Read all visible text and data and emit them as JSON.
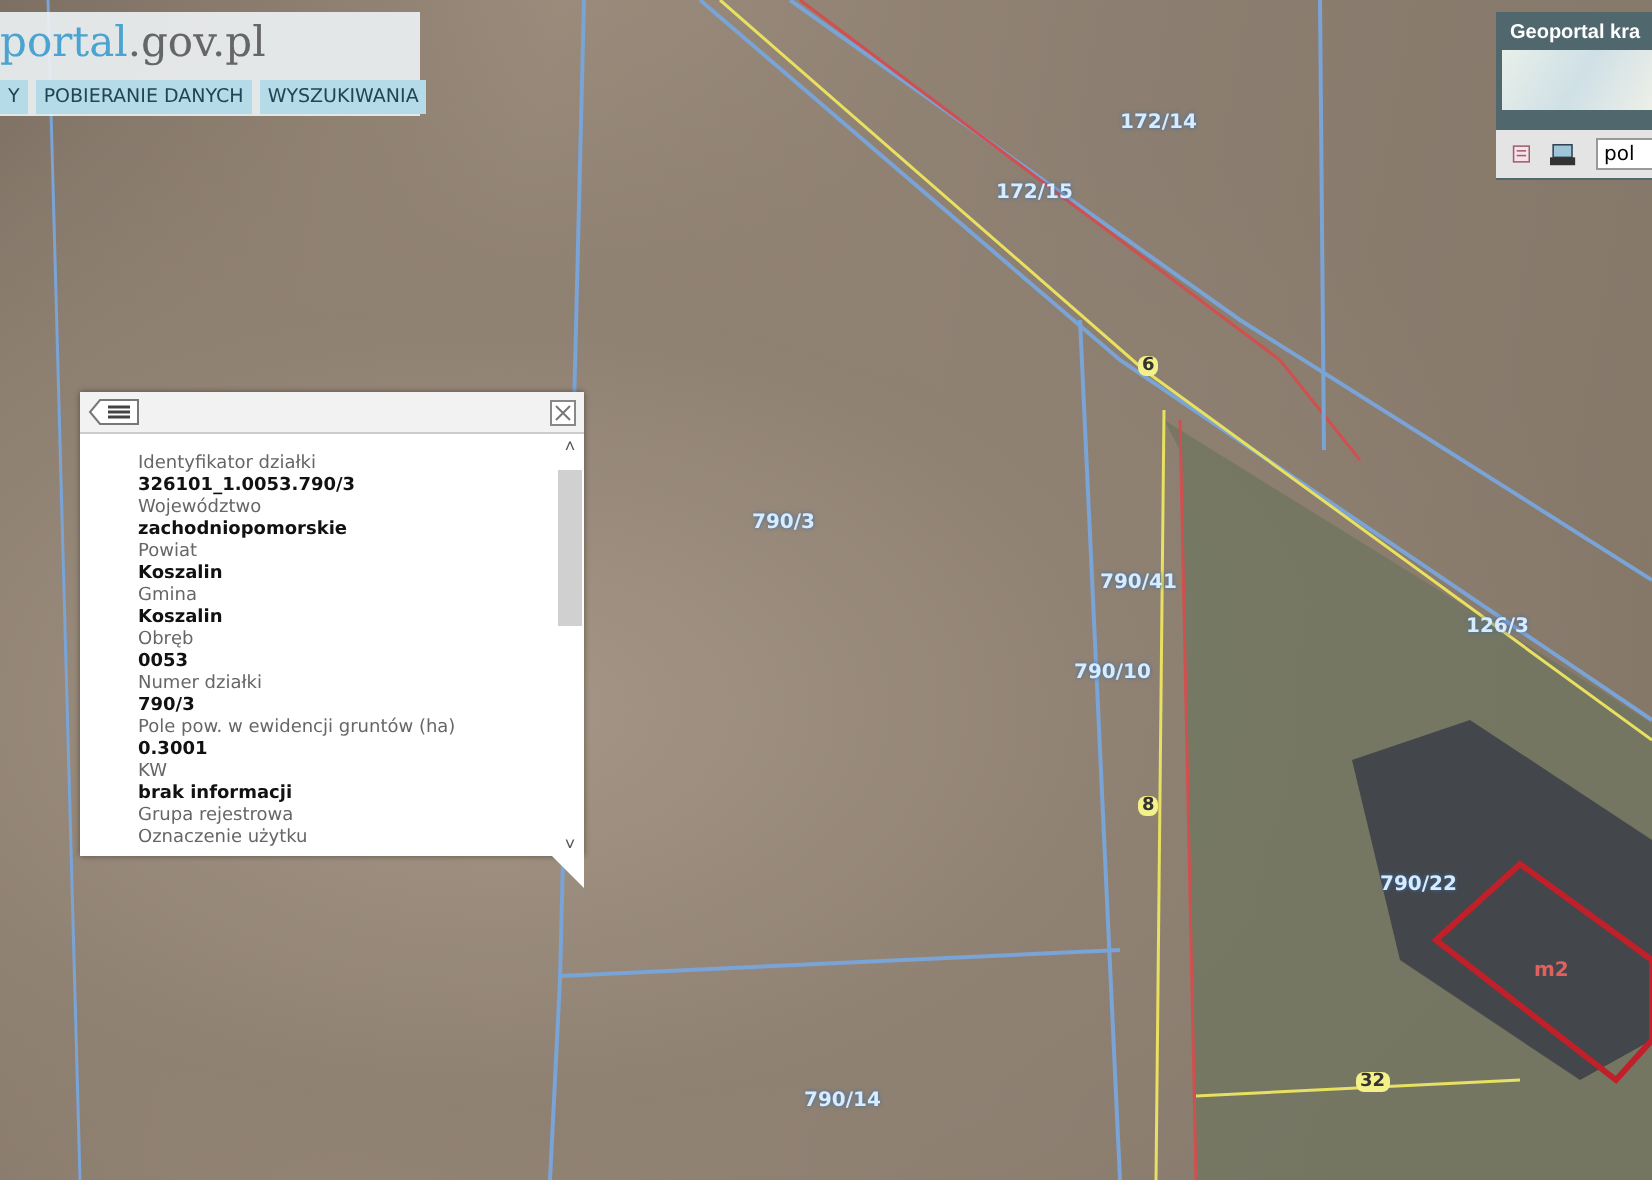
{
  "header": {
    "logo_main": "portal",
    "logo_suffix": ".gov.pl",
    "tabs": [
      {
        "label": "Y",
        "selected": false
      },
      {
        "label": "POBIERANIE DANYCH",
        "selected": false
      },
      {
        "label": "WYSZUKIWANIA",
        "selected": false
      }
    ]
  },
  "overview": {
    "title": "Geoportal kra",
    "search": {
      "value": "pol"
    }
  },
  "map_labels": [
    {
      "text": "172/14",
      "kind": "parcel"
    },
    {
      "text": "172/15",
      "kind": "parcel"
    },
    {
      "text": "790/3",
      "kind": "parcel"
    },
    {
      "text": "790/41",
      "kind": "parcel"
    },
    {
      "text": "790/10",
      "kind": "parcel"
    },
    {
      "text": "126/3",
      "kind": "parcel"
    },
    {
      "text": "790/22",
      "kind": "parcel"
    },
    {
      "text": "790/14",
      "kind": "parcel"
    },
    {
      "text": "6",
      "kind": "road"
    },
    {
      "text": "8",
      "kind": "road"
    },
    {
      "text": "32",
      "kind": "road"
    },
    {
      "text": "m2",
      "kind": "building"
    }
  ],
  "info_panel": {
    "scroll_up": "˄",
    "scroll_down": "˅",
    "fields": [
      {
        "label": "Identyfikator działki",
        "value": "326101_1.0053.790/3"
      },
      {
        "label": "Województwo",
        "value": "zachodniopomorskie"
      },
      {
        "label": "Powiat",
        "value": "Koszalin"
      },
      {
        "label": "Gmina",
        "value": "Koszalin"
      },
      {
        "label": "Obręb",
        "value": "0053"
      },
      {
        "label": "Numer działki",
        "value": "790/3"
      },
      {
        "label": "Pole pow. w ewidencji gruntów (ha)",
        "value": "0.3001"
      },
      {
        "label": "KW",
        "value": "brak informacji"
      },
      {
        "label": "Grupa rejestrowa"
      },
      {
        "label": "Oznaczenie użytku"
      }
    ]
  }
}
